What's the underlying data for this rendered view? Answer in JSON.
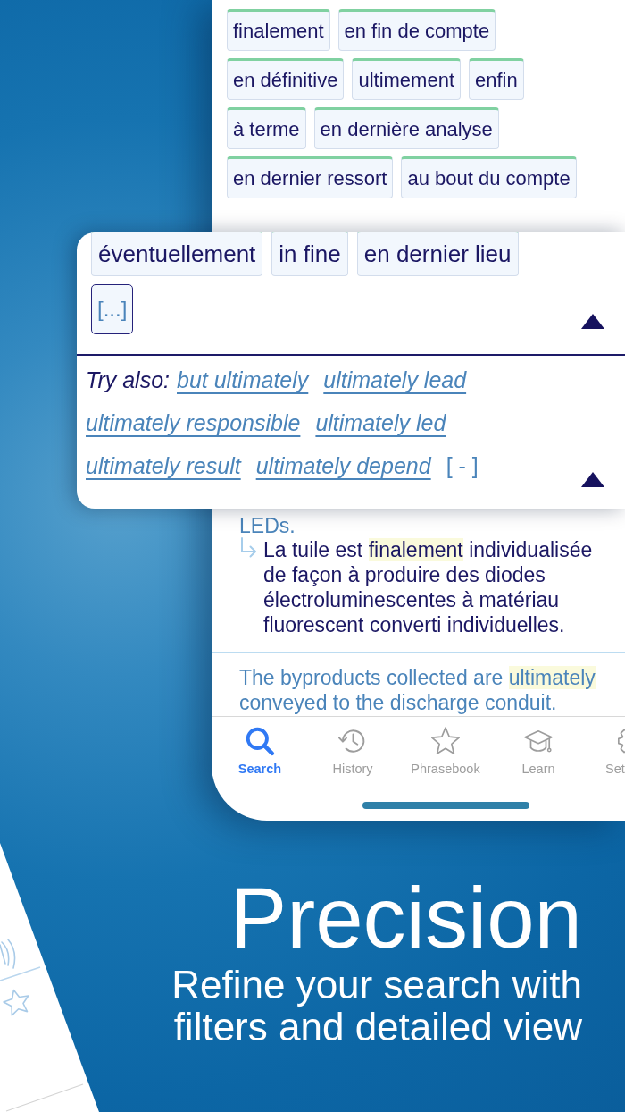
{
  "phone": {
    "synonym_rows": [
      [
        "finalement",
        "en fin de compte"
      ],
      [
        "en définitive",
        "ultimement",
        "enfin"
      ],
      [
        "à terme",
        "en dernière analyse"
      ],
      [
        "en dernier ressort",
        "au bout du compte"
      ]
    ],
    "example_tail": "LEDs.",
    "translation_parts": [
      {
        "text": "La tuile est ",
        "highlighted": false
      },
      {
        "text": "finalement",
        "highlighted": true
      },
      {
        "text": " individualisée de façon à produire des diodes électroluminescentes à matériau fluorescent converti individuelles.",
        "highlighted": false
      }
    ],
    "example_parts": [
      {
        "text": "The byproducts collected are ",
        "highlighted": false
      },
      {
        "text": "ultimately",
        "highlighted": true
      },
      {
        "text": " conveyed to the discharge conduit.",
        "highlighted": false
      }
    ],
    "tabs": [
      {
        "label": "Search",
        "selected": true
      },
      {
        "label": "History",
        "selected": false
      },
      {
        "label": "Phrasebook",
        "selected": false
      },
      {
        "label": "Learn",
        "selected": false
      },
      {
        "label": "Set",
        "selected": false
      }
    ]
  },
  "popup": {
    "synonym_rows": [
      [
        "éventuellement",
        "in fine",
        "en dernier lieu"
      ]
    ],
    "more_button": "[...]",
    "try_also_label": "Try also:",
    "suggestions": [
      "but ultimately",
      "ultimately lead",
      "ultimately responsible",
      "ultimately led",
      "ultimately result",
      "ultimately depend"
    ],
    "less_button": "[ - ]"
  },
  "headline": "Precision",
  "subtitle": "Refine your search with filters and detailed view"
}
